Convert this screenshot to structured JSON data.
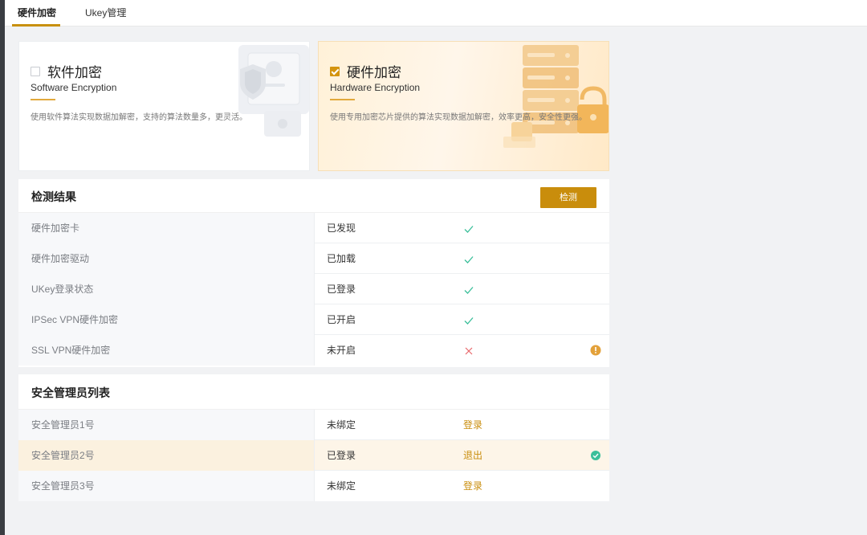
{
  "tabs": [
    {
      "label": "硬件加密",
      "active": true
    },
    {
      "label": "Ukey管理",
      "active": false
    }
  ],
  "modes": {
    "software": {
      "title_cn": "软件加密",
      "title_en": "Software Encryption",
      "desc": "使用软件算法实现数据加解密，支持的算法数量多，更灵活。",
      "checked": false
    },
    "hardware": {
      "title_cn": "硬件加密",
      "title_en": "Hardware Encryption",
      "desc": "使用专用加密芯片提供的算法实现数据加解密，效率更高，安全性更强。",
      "checked": true
    }
  },
  "detection": {
    "title": "检测结果",
    "button_label": "检测",
    "rows": [
      {
        "item": "硬件加密卡",
        "status": "已发现",
        "ok": true
      },
      {
        "item": "硬件加密驱动",
        "status": "已加载",
        "ok": true
      },
      {
        "item": "UKey登录状态",
        "status": "已登录",
        "ok": true
      },
      {
        "item": "IPSec VPN硬件加密",
        "status": "已开启",
        "ok": true
      },
      {
        "item": "SSL VPN硬件加密",
        "status": "未开启",
        "ok": false,
        "warning": true
      }
    ]
  },
  "admins": {
    "title": "安全管理员列表",
    "rows": [
      {
        "name": "安全管理员1号",
        "status": "未绑定",
        "action": "登录",
        "current": false
      },
      {
        "name": "安全管理员2号",
        "status": "已登录",
        "action": "退出",
        "current": true
      },
      {
        "name": "安全管理员3号",
        "status": "未绑定",
        "action": "登录",
        "current": false
      }
    ]
  },
  "colors": {
    "accent": "#c98d0c",
    "ok": "#3bbf9a",
    "error": "#e8686b",
    "warning": "#e3a13a"
  }
}
